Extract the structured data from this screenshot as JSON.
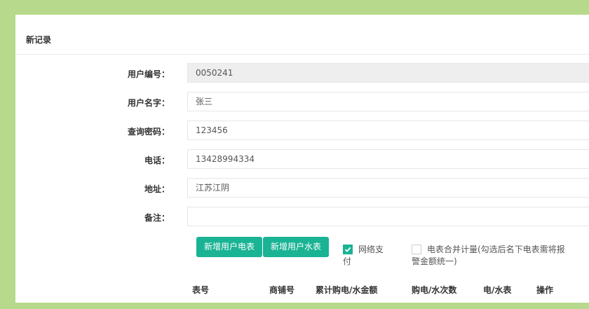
{
  "panel": {
    "title": "新记录"
  },
  "form": {
    "user_id": {
      "label": "用户编号：",
      "value": "0050241"
    },
    "user_name": {
      "label": "用户名字：",
      "value": "张三"
    },
    "query_password": {
      "label": "查询密码：",
      "value": "123456"
    },
    "phone": {
      "label": "电话：",
      "value": "13428994334"
    },
    "address": {
      "label": "地址：",
      "value": "江苏江阴"
    },
    "remark": {
      "label": "备注：",
      "value": ""
    }
  },
  "buttons": {
    "add_electric_meter": "新增用户电表",
    "add_water_meter": "新增用户水表"
  },
  "options": {
    "online_payment": {
      "label_line1": "网络支",
      "label_line2": "付",
      "checked": true
    },
    "merge_meter": {
      "label_line1": "电表合并计量(勾选后名下电表需将报",
      "label_line2": "警金额统一)",
      "checked": false
    }
  },
  "table": {
    "headers": [
      "表号",
      "商铺号",
      "累计购电/水金额",
      "购电/水次数",
      "电/水表",
      "操作"
    ]
  },
  "colors": {
    "accent": "#1ab394",
    "frame": "#b7d98c"
  }
}
